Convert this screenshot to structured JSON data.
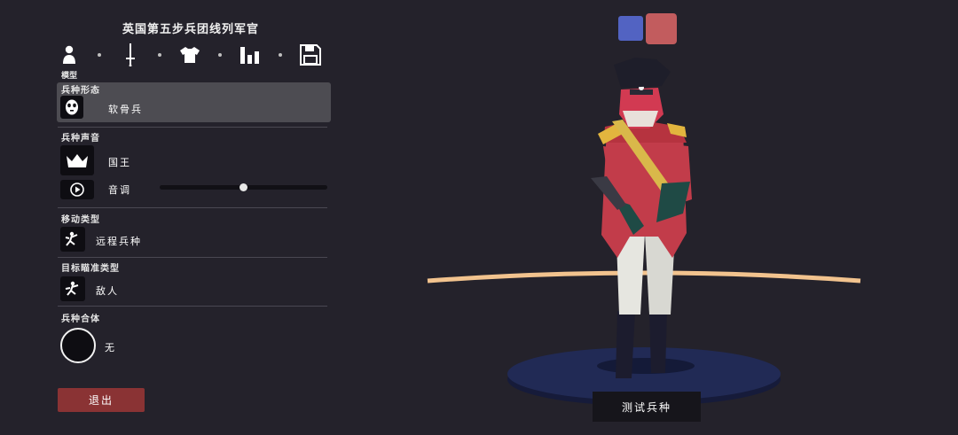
{
  "editor": {
    "title": "英国第五步兵团线列军官",
    "tabs": [
      {
        "id": "model",
        "icon": "person-icon",
        "label": "模型",
        "active": true
      },
      {
        "id": "weapon",
        "icon": "sword-icon"
      },
      {
        "id": "clothing",
        "icon": "shirt-icon"
      },
      {
        "id": "stats",
        "icon": "bar-chart-icon"
      },
      {
        "id": "save",
        "icon": "save-icon"
      }
    ],
    "active_tab_label": "模型",
    "sections": {
      "body": {
        "label": "兵种形态",
        "value": "软骨兵",
        "icon": "mask-icon"
      },
      "voice": {
        "label": "兵种声音",
        "value": "国王",
        "icon": "crown-icon",
        "pitch_label": "音调",
        "pitch_icon": "play-icon",
        "pitch_level": 0.5
      },
      "movement": {
        "label": "移动类型",
        "value": "远程兵种",
        "icon": "ranged-unit-icon"
      },
      "targeting": {
        "label": "目标瞄准类型",
        "value": "敌人",
        "icon": "target-enemy-icon"
      },
      "merge": {
        "label": "兵种合体",
        "value": "无"
      }
    },
    "exit_label": "退出"
  },
  "preview": {
    "team_colors": {
      "blue": "#5263c2",
      "red": "#c25c5e"
    },
    "test_label": "测试兵种"
  }
}
